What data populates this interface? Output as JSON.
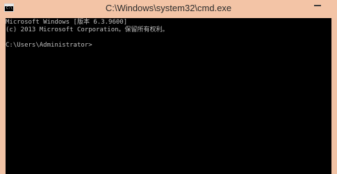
{
  "window": {
    "title": "C:\\Windows\\system32\\cmd.exe",
    "icon_name": "cmd-app-icon",
    "icon_glyph": "C:\\"
  },
  "console": {
    "lines": [
      "Microsoft Windows [版本 6.3.9600]",
      "(c) 2013 Microsoft Corporation。保留所有权利。",
      "C:\\Users\\Administrator>"
    ]
  },
  "colors": {
    "titlebar": "#f3c4a6",
    "console_bg": "#000000",
    "console_text": "#c0c0c0"
  }
}
